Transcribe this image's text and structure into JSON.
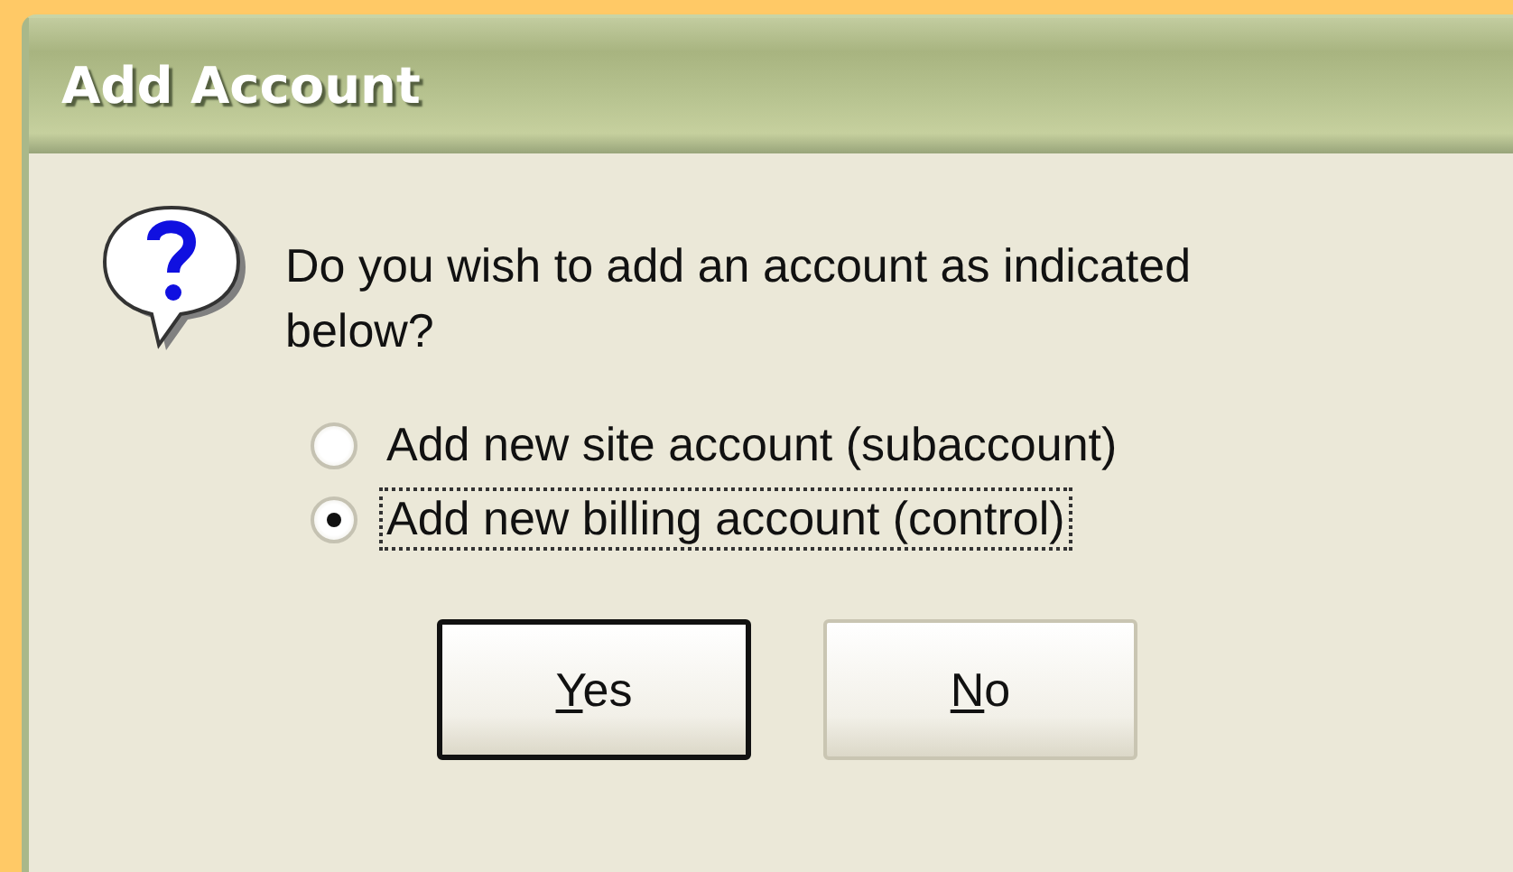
{
  "window": {
    "title": "Add Account"
  },
  "message": "Do you wish to add an account as indicated below?",
  "options": [
    {
      "label": "Add new site account (subaccount)",
      "selected": false,
      "focused": false
    },
    {
      "label": "Add new billing account (control)",
      "selected": true,
      "focused": true
    }
  ],
  "buttons": [
    {
      "label": "Yes",
      "first_letter_underlined": true,
      "default": true
    },
    {
      "label": "No",
      "first_letter_underlined": true,
      "default": false
    }
  ]
}
